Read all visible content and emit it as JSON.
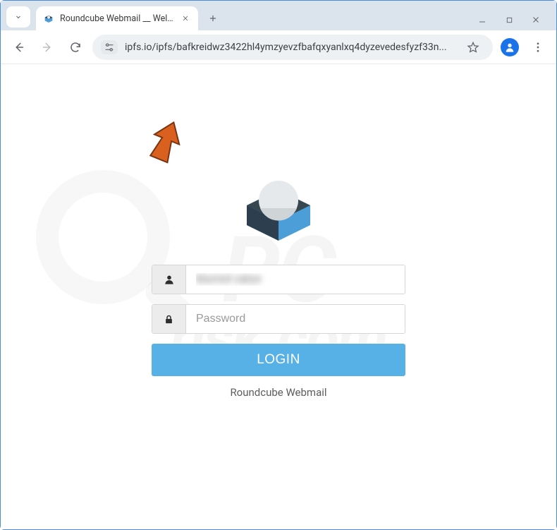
{
  "tab": {
    "title": "Roundcube Webmail __ Welcom"
  },
  "url": {
    "display": "ipfs.io/ipfs/bafkreidwz3422hl4ymzyevzfbafqxyanlxq4dyzevedesfyzf33n..."
  },
  "login": {
    "username_value": "blurred value",
    "password_placeholder": "Password",
    "button_label": "LOGIN",
    "footer": "Roundcube Webmail"
  },
  "watermark": {
    "line1": "PC",
    "line2": "risk.com"
  }
}
